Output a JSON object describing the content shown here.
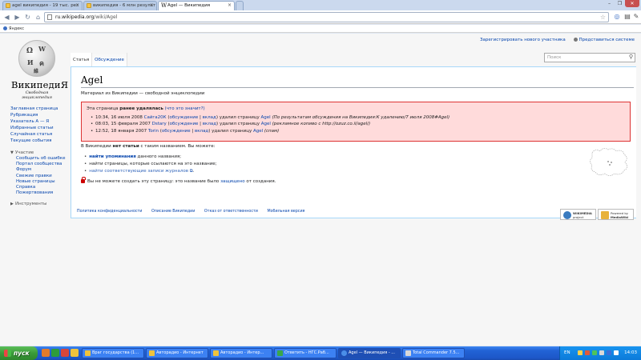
{
  "browser": {
    "tabs": [
      {
        "title": "agel википедия - 19 тыс. рез"
      },
      {
        "title": "википедия - 6 млн результ"
      },
      {
        "title": "Agel — Википедия"
      }
    ],
    "url_domain": "ru.wikipedia.org",
    "url_path": "/wiki/Agel",
    "bookmark": "Яндекс"
  },
  "wiki": {
    "personal": {
      "register": "Зарегистрировать нового участника",
      "login": "Представиться системе"
    },
    "logo": {
      "wordmark": "ВикипедиЯ",
      "tagline": "Свободная энциклопедия"
    },
    "nav": [
      "Заглавная страница",
      "Рубрикация",
      "Указатель А — Я",
      "Избранные статьи",
      "Случайная статья",
      "Текущие события"
    ],
    "portal_heading": "Участие",
    "portal_items": [
      "Сообщить об ошибке",
      "Портал сообщества",
      "Форум",
      "Свежие правки",
      "Новые страницы",
      "Справка",
      "Пожертвования"
    ],
    "tools_heading": "Инструменты",
    "view_tabs": [
      "Статья",
      "Обсуждение"
    ],
    "search_placeholder": "Поиск",
    "title": "Agel",
    "site_sub": "Материал из Википедии — свободной энциклопедии",
    "deleted": {
      "lead_pre": "Эта страница ",
      "lead_bold": "ранее удалялась",
      "lead_link": "(что это значит?)",
      "entries": [
        {
          "date": "10:34, 16 июля 2008",
          "user": "Сайга20К",
          "talk": "обсуждение",
          "contrib": "вклад",
          "action": "удалил страницу",
          "page": "Agel",
          "reason": "(По результатам обсуждения на Википедия:К удалению/7 июля 2008#Agel)"
        },
        {
          "date": "08:03, 15 февраля 2007",
          "user": "Dstary",
          "talk": "обсуждение",
          "contrib": "вклад",
          "action": "удалил страницу",
          "page": "Agel",
          "reason": "(рекламное копиво с http://ozuz.co.il/agel/)"
        },
        {
          "date": "12:52, 18 января 2007",
          "user": "Torin",
          "talk": "обсуждение",
          "contrib": "вклад",
          "action": "удалил страницу",
          "page": "Agel",
          "reason": "(спам)"
        }
      ]
    },
    "noarticle": {
      "pre": "В Википедии ",
      "bold": "нет статьи",
      "post": " с таким названием. Вы можете:"
    },
    "options": [
      {
        "link": "найти упоминания",
        "rest": " данного названия;"
      },
      {
        "link": "",
        "rest": "найти страницы, которые ссылаются на это название;"
      },
      {
        "link": "найти соответствующие записи журналов",
        "rest": ""
      }
    ],
    "protected": {
      "pre": "Вы не можете создать эту страницу: это название было ",
      "link": "защищено",
      "post": " от создания."
    },
    "footer": [
      "Политика конфиденциальности",
      "Описание Википедии",
      "Отказ от ответственности",
      "Мобильная версия"
    ],
    "badge1": [
      "WIKIMEDIA",
      "project"
    ],
    "badge2": [
      "Powered by",
      "MediaWiki"
    ]
  },
  "taskbar": {
    "start": "пуск",
    "tasks": [
      "Враг государства (1...",
      "Авторадио - Интернет",
      "Авторадио - Интер...",
      "Ответить - НГС.Раб...",
      "Agel — Википедия - ...",
      "Total Commander 7.5..."
    ],
    "lang": "EN",
    "clock": "14:03"
  }
}
